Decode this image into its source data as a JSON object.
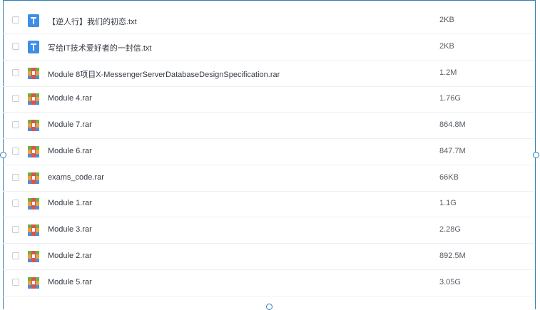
{
  "files": [
    {
      "name": "【逆人行】我们的初恋.txt",
      "size": "2KB",
      "type": "txt"
    },
    {
      "name": "写给IT技术爱好者的一封信.txt",
      "size": "2KB",
      "type": "txt"
    },
    {
      "name": "Module 8项目X-MessengerServerDatabaseDesignSpecification.rar",
      "size": "1.2M",
      "type": "rar"
    },
    {
      "name": "Module 4.rar",
      "size": "1.76G",
      "type": "rar"
    },
    {
      "name": "Module 7.rar",
      "size": "864.8M",
      "type": "rar"
    },
    {
      "name": "Module 6.rar",
      "size": "847.7M",
      "type": "rar"
    },
    {
      "name": "exams_code.rar",
      "size": "66KB",
      "type": "rar"
    },
    {
      "name": "Module 1.rar",
      "size": "1.1G",
      "type": "rar"
    },
    {
      "name": "Module 3.rar",
      "size": "2.28G",
      "type": "rar"
    },
    {
      "name": "Module 2.rar",
      "size": "892.5M",
      "type": "rar"
    },
    {
      "name": "Module 5.rar",
      "size": "3.05G",
      "type": "rar"
    }
  ],
  "icons": {
    "txt": {
      "name": "txt-file-icon",
      "letter": "T",
      "color": "#3d8ee8"
    },
    "rar": {
      "name": "rar-archive-icon",
      "color": "#e9a23b"
    }
  },
  "colors": {
    "border": "#2f7fb3",
    "divider": "#eef0f3"
  }
}
